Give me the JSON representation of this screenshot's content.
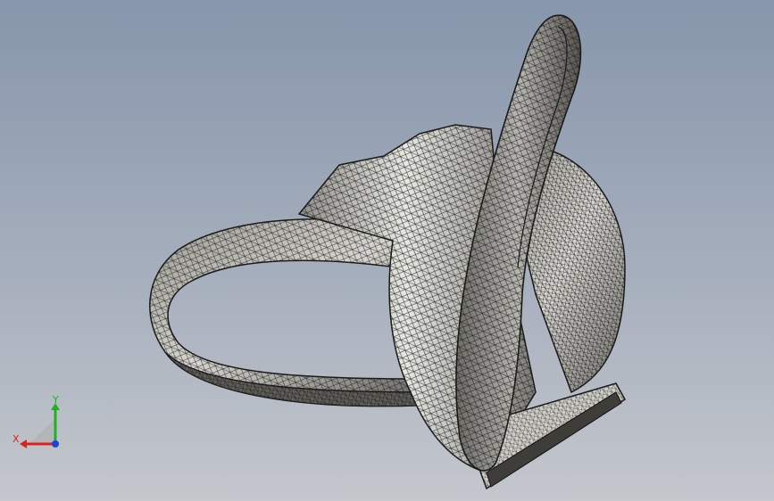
{
  "viewport": {
    "background_top": "#8796ab",
    "background_bottom": "#c4c7cc"
  },
  "model": {
    "render_mode": "shaded-with-mesh-edges",
    "surface_color": "#b9b8b2",
    "edge_color": "#1a1a1a"
  },
  "triad": {
    "x_label": "X",
    "y_label": "Y",
    "x_color": "#e02020",
    "y_color": "#22b022",
    "z_color": "#2040e0"
  }
}
